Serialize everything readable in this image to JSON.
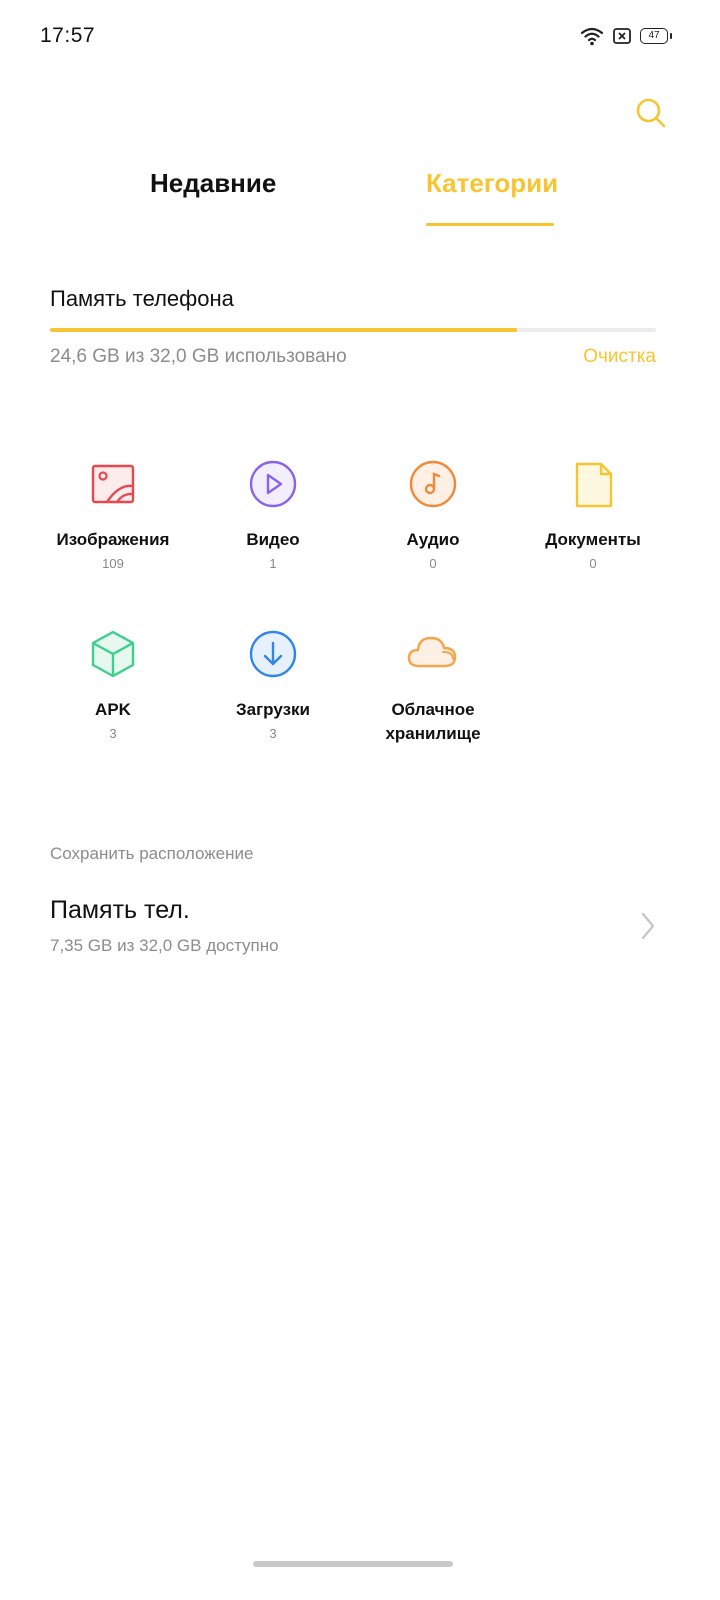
{
  "status_bar": {
    "time": "17:57",
    "battery": "47"
  },
  "tabs": [
    {
      "label": "Недавние",
      "active": false
    },
    {
      "label": "Категории",
      "active": true
    }
  ],
  "accent_color": "#f7c531",
  "storage": {
    "title": "Память телефона",
    "usage_text": "24,6 GB из 32,0 GB использовано",
    "used_fraction": 0.77,
    "cleanup_label": "Очистка"
  },
  "categories": [
    {
      "label": "Изображения",
      "count": "109",
      "icon": "image-icon"
    },
    {
      "label": "Видео",
      "count": "1",
      "icon": "video-icon"
    },
    {
      "label": "Аудио",
      "count": "0",
      "icon": "audio-icon"
    },
    {
      "label": "Документы",
      "count": "0",
      "icon": "document-icon"
    },
    {
      "label": "APK",
      "count": "3",
      "icon": "apk-icon"
    },
    {
      "label": "Загрузки",
      "count": "3",
      "icon": "download-icon"
    },
    {
      "label": "Облачное хранилище",
      "count": "",
      "icon": "cloud-icon"
    }
  ],
  "save_location": {
    "section_label": "Сохранить расположение",
    "title": "Память тел.",
    "subtitle": "7,35 GB из 32,0 GB доступно"
  }
}
